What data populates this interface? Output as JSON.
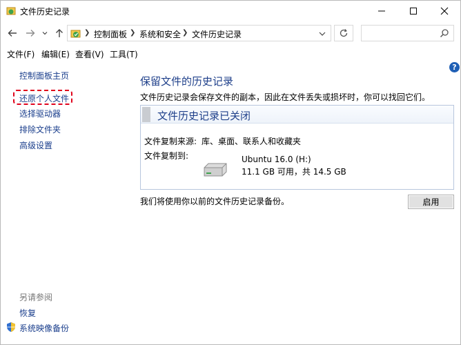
{
  "window": {
    "title": "文件历史记录"
  },
  "address": {
    "breadcrumbs": [
      "控制面板",
      "系统和安全",
      "文件历史记录"
    ],
    "search_placeholder": ""
  },
  "menu": [
    "文件(F)",
    "编辑(E)",
    "查看(V)",
    "工具(T)"
  ],
  "sidebar": {
    "home_link": "控制面板主页",
    "links": [
      "还原个人文件",
      "选择驱动器",
      "排除文件夹",
      "高级设置"
    ],
    "see_also_title": "另请参阅",
    "see_also": [
      "恢复",
      "系统映像备份"
    ]
  },
  "main": {
    "title": "保留文件的历史记录",
    "description": "文件历史记录会保存文件的副本，因此在文件丢失或损坏时，你可以找回它们。",
    "status_title": "文件历史记录已关闭",
    "source_label": "文件复制来源:",
    "source_value": "库、桌面、联系人和收藏夹",
    "dest_label": "文件复制到:",
    "drive_name": "Ubuntu 16.0 (H:)",
    "drive_space": "11.1 GB 可用，共 14.5 GB",
    "footer_note": "我们将使用你以前的文件历史记录备份。",
    "enable_button": "启用"
  },
  "colors": {
    "link": "#1a3e8c",
    "highlight_box": "#e0001a",
    "help": "#1f5fb5"
  },
  "icons": [
    "file-history-icon",
    "back-arrow-icon",
    "forward-arrow-icon",
    "up-arrow-icon",
    "refresh-icon",
    "search-icon",
    "help-icon",
    "drive-icon",
    "shield-icon"
  ]
}
